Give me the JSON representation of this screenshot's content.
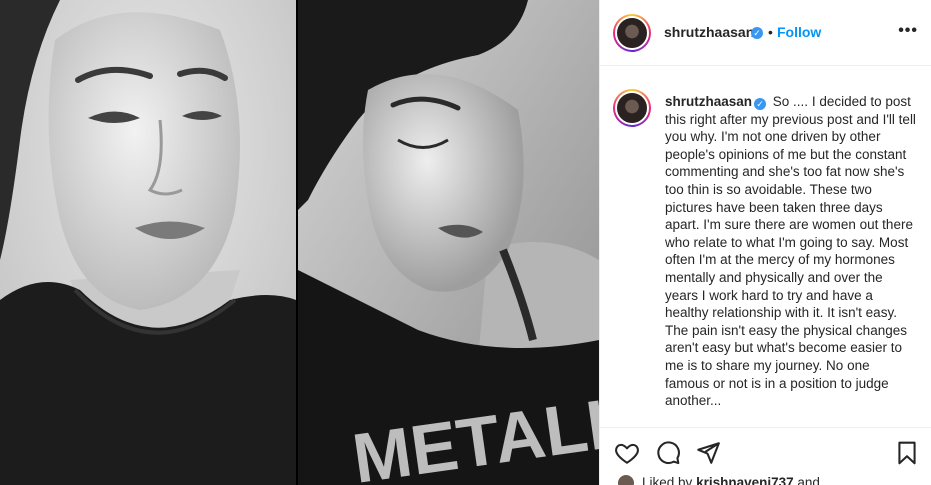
{
  "post": {
    "username": "shrutzhaasan",
    "verified_mark": "✓",
    "separator": "•",
    "follow_label": "Follow",
    "more_label": "•••",
    "caption_username": "shrutzhaasan",
    "caption_text": "So .... I decided to post this right after my previous post and I'll tell you why. I'm not one driven by other people's opinions of me but the constant commenting and she's too fat now she's too thin is so avoidable. These two pictures have been taken three days apart. I'm sure there are women out there who relate to what I'm going to say. Most often I'm at the mercy of my hormones mentally and physically and over the years I work hard to try and have a healthy relationship with it. It isn't easy. The pain isn't easy the physical changes aren't easy but what's become easier to me is to share my journey. No one famous or not is in a position to judge another..."
  },
  "shirt_text": "METALLIC",
  "actions": {
    "like_icon": "heart-icon",
    "comment_icon": "comment-bubble-icon",
    "share_icon": "paper-plane-icon",
    "save_icon": "bookmark-icon"
  },
  "likes": {
    "prefix": "Liked by",
    "user": "krishnaveni737",
    "suffix": "and"
  }
}
